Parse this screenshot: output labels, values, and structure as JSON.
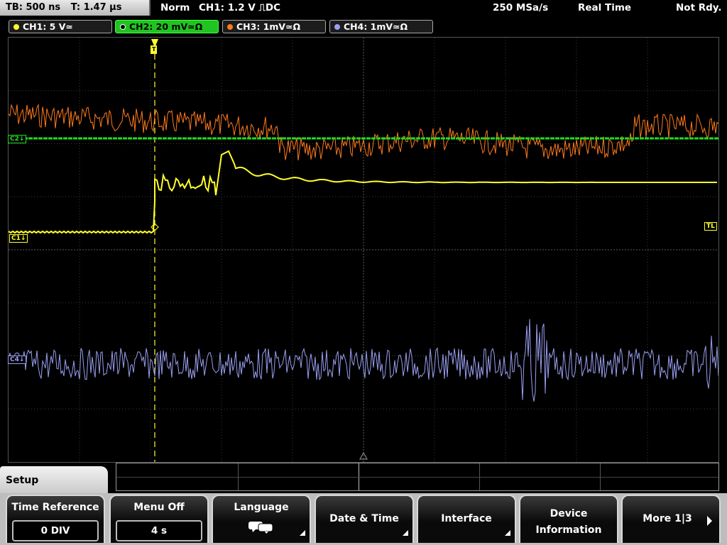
{
  "topbar": {
    "timebase": "TB: 500 ns",
    "trigger_time": "T: 1.47 µs",
    "trigger_mode": "Norm",
    "trigger_source": "CH1: 1.2 V ⎍DC",
    "sample_rate": "250 MSa/s",
    "acq_mode": "Real Time",
    "status": "Not Rdy."
  },
  "channels": [
    {
      "label": "CH1: 5 V≃",
      "color": "#ffff2a",
      "active": false
    },
    {
      "label": "CH2: 20 mV≃Ω",
      "color": "#22dd22",
      "active": true
    },
    {
      "label": "CH3: 1mV≃Ω",
      "color": "#ff7a1c",
      "active": false
    },
    {
      "label": "CH4: 1mV≃Ω",
      "color": "#9a9ff0",
      "active": false
    }
  ],
  "markers": {
    "ch1": "C1↓",
    "ch2": "C2↓",
    "ch4": "C4↓",
    "trigger_level": "TL",
    "trigger_pos": "T"
  },
  "menu": {
    "title": "Setup",
    "softkeys": [
      {
        "label": "Time Reference",
        "value": "0 DIV"
      },
      {
        "label": "Menu Off",
        "value": "4 s"
      },
      {
        "label": "Language",
        "icon": "speech-bubbles-icon"
      },
      {
        "label": "Date & Time"
      },
      {
        "label": "Interface"
      },
      {
        "label": "Device Information"
      },
      {
        "label": "More 1|3"
      }
    ]
  },
  "colors": {
    "ch1": "#ffff2a",
    "ch2": "#22dd22",
    "ch3": "#ff7a1c",
    "ch4": "#9a9ff0",
    "grid": "#5a5a5a"
  }
}
